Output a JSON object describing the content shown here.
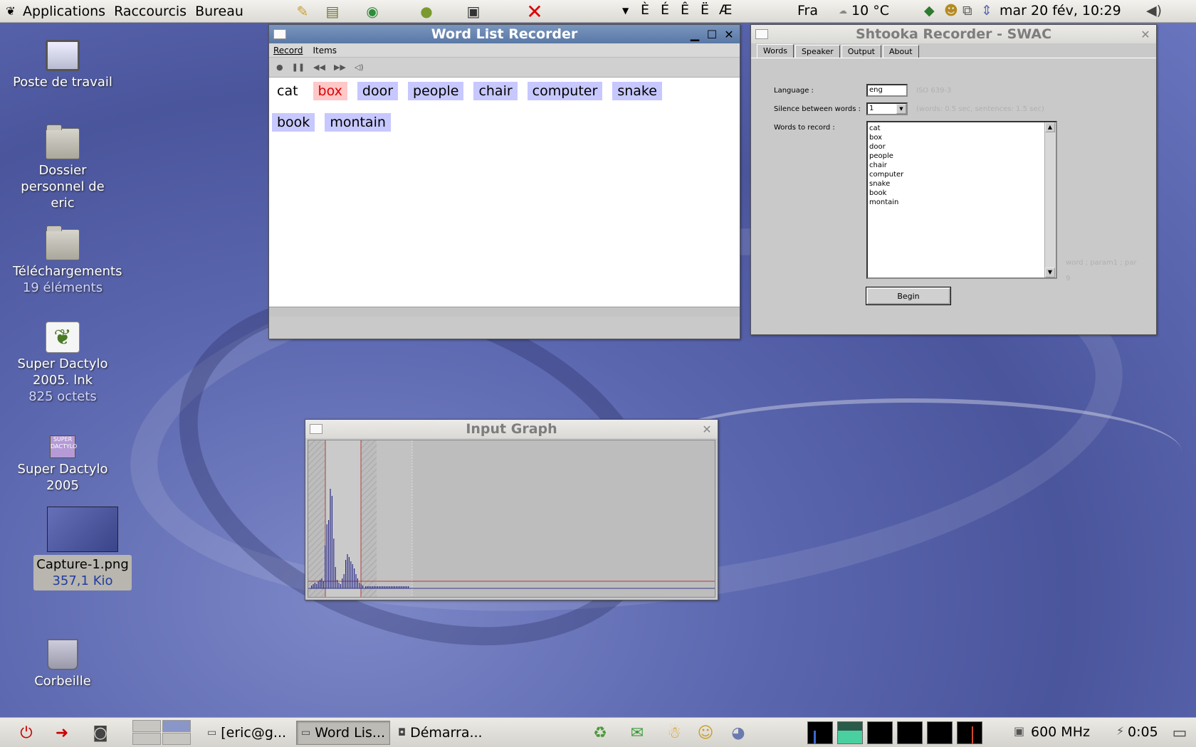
{
  "top_panel": {
    "menus": [
      "Applications",
      "Raccourcis",
      "Bureau"
    ],
    "accent_chars": [
      "È",
      "É",
      "Ê",
      "Ë",
      "Æ"
    ],
    "keyboard_layout": "Fra",
    "weather": "10 °C",
    "clock": "mar 20 fév, 10:29"
  },
  "desktop": {
    "icons": [
      {
        "label": "Poste de travail",
        "sub": ""
      },
      {
        "label": "Dossier personnel de eric",
        "sub": ""
      },
      {
        "label": "Téléchargements",
        "sub": "19 éléments"
      },
      {
        "label": "Super Dactylo 2005. lnk",
        "sub": "825 octets"
      },
      {
        "label": "Super Dactylo 2005",
        "sub": ""
      },
      {
        "label": "Capture-1.png",
        "sub": "357,1 Kio"
      },
      {
        "label": "Corbeille",
        "sub": ""
      }
    ],
    "dactylo_badge": "SUPER DACTYLO"
  },
  "word_list": {
    "title": "Word List Recorder",
    "menus": [
      "Record",
      "Items"
    ],
    "words": [
      "cat",
      "box",
      "door",
      "people",
      "chair",
      "computer",
      "snake",
      "book",
      "montain"
    ],
    "current_word": "box"
  },
  "swac": {
    "title": "Shtooka Recorder - SWAC",
    "tabs": [
      "Words",
      "Speaker",
      "Output",
      "About"
    ],
    "language_label": "Language :",
    "language_value": "eng",
    "language_hint": "ISO 639-3",
    "silence_label": "Silence between words :",
    "silence_value": "1",
    "silence_hint": "(words: 0.5 sec, sentences: 1.5 sec)",
    "words_label": "Words to record :",
    "words_list": [
      "cat",
      "box",
      "door",
      "people",
      "chair",
      "computer",
      "snake",
      "book",
      "montain"
    ],
    "format_hint": "word ; param1 ; par",
    "format_hint2": "9",
    "begin_label": "Begin"
  },
  "input_graph": {
    "title": "Input Graph"
  },
  "bottom_panel": {
    "tasks": [
      "[eric@g...",
      "Word Lis...",
      "Démarra..."
    ],
    "cpu_freq": "600 MHz",
    "battery_time": "0:05"
  }
}
